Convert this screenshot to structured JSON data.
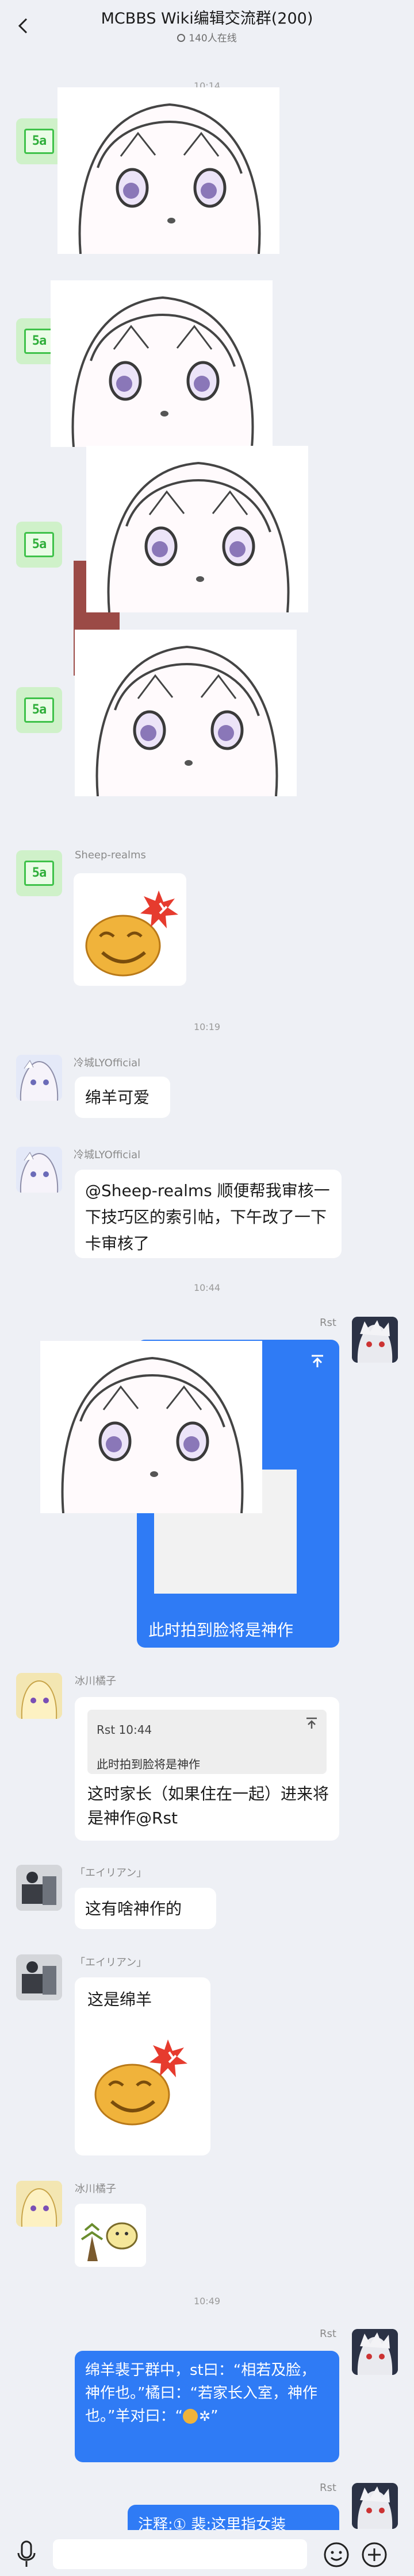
{
  "header": {
    "title": "MCBBS Wiki编辑交流群(200)",
    "online": "140人在线"
  },
  "times": [
    "10:14",
    "10:19",
    "10:44",
    "10:49"
  ],
  "messages": {
    "sheep_name": "Sheep-realms",
    "ly_name": "冷城LYOfficial",
    "ly_text1": "绵羊可爱",
    "ly_text2": "@Sheep-realms 顺便帮我审核一下技巧区的索引帖，下午改了一下卡审核了",
    "rst_name": "Rst",
    "rst_text1": "此时拍到脸将是神作",
    "bing_name": "冰川橘子",
    "quote_head": "Rst 10:44",
    "quote_text": "此时拍到脸将是神作",
    "bing_text": "这时家长（如果住在一起）进来将是神作@Rst",
    "alien_name": "「エイリアン」",
    "alien_text1": "这有啥神作的",
    "alien_text2": "这是绵羊",
    "rst_text2": "绵羊裴于群中，st曰：“相若及脸，神作也。”橘曰：“若家长入室，神作也。”羊对曰：“",
    "rst_text2_tail": "”",
    "rst_text3": "注释:① 裴:这里指女装"
  },
  "bot_label": "5a",
  "colors": {
    "accent": "#2f7bf5",
    "bot_green": "#3fc24a"
  }
}
